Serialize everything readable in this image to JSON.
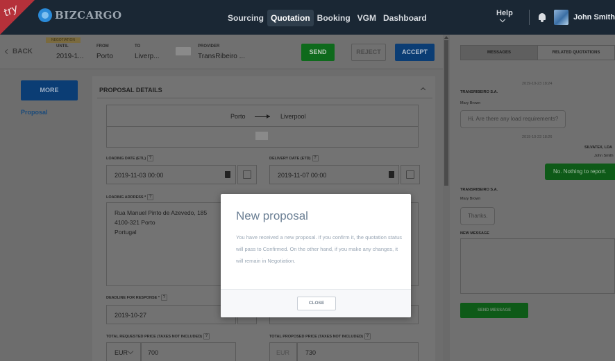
{
  "brand": {
    "try_label": "try",
    "name": "BIZCARGO"
  },
  "nav": {
    "items": [
      "Sourcing",
      "Quotation",
      "Booking",
      "VGM",
      "Dashboard"
    ],
    "active": "Quotation"
  },
  "topright": {
    "help": "Help",
    "user": "John Smith"
  },
  "subbar": {
    "back": "BACK",
    "status_tag": "NEGOTIATION",
    "until_label": "UNTIL",
    "until_value": "2019-1...",
    "from_label": "FROM",
    "from_value": "Porto",
    "to_label": "TO",
    "to_value": "Liverp...",
    "provider_label": "PROVIDER",
    "provider_value": "TransRibeiro ...",
    "send": "SEND",
    "reject": "REJECT",
    "accept": "ACCEPT"
  },
  "sidebar": {
    "more": "MORE",
    "proposal": "Proposal"
  },
  "proposal": {
    "title": "PROPOSAL DETAILS",
    "route_from": "Porto",
    "route_to": "Liverpool",
    "loading_date_label": "LOADING DATE (ETL)",
    "loading_date": "2019-11-03 00:00",
    "delivery_date_label": "DELIVERY DATE (ETD)",
    "delivery_date": "2019-11-07 00:00",
    "loading_address_label": "LOADING ADDRESS *",
    "address_lines": [
      "Rua Manuel Pinto de Azevedo, 185",
      "4100-321 Porto",
      "Portugal"
    ],
    "deadline_label": "DEADLINE FOR RESPONSE *",
    "deadline": "2019-10-27",
    "requested_price_label": "TOTAL REQUESTED PRICE (TAXES NOT INCLUDED)",
    "requested_currency": "EUR",
    "requested_price": "700",
    "proposed_price_label": "TOTAL PROPOSED PRICE (TAXES NOT INCLUDED)",
    "proposed_currency": "EUR",
    "proposed_price": "730",
    "help_mark": "?"
  },
  "messages": {
    "tabs": [
      "MESSAGES",
      "RELATED QUOTATIONS"
    ],
    "stamp1": "2019-10-23 18:24",
    "sender1_company": "TRANSRIBEIRO S.A.",
    "sender1_name": "Mary Brown",
    "msg1": "Hi. Are there any load requirements?",
    "stamp2": "2019-10-23 18:26",
    "sender2_company": "SILVATEX, LDA",
    "sender2_name": "John Smith",
    "msg2": "No. Nothing to report.",
    "sender3_company": "TRANSRIBEIRO S.A.",
    "sender3_name": "Mary Brown",
    "msg3": "Thanks.",
    "new_label": "NEW MESSAGE",
    "send_btn": "SEND MESSAGE"
  },
  "modal": {
    "title": "New proposal",
    "body": "You have received a new proposal. If you confirm it, the quotation status will pass to Confirmed. On the other hand, if you make any changes, it will remain in Negotiation.",
    "close": "CLOSE"
  }
}
